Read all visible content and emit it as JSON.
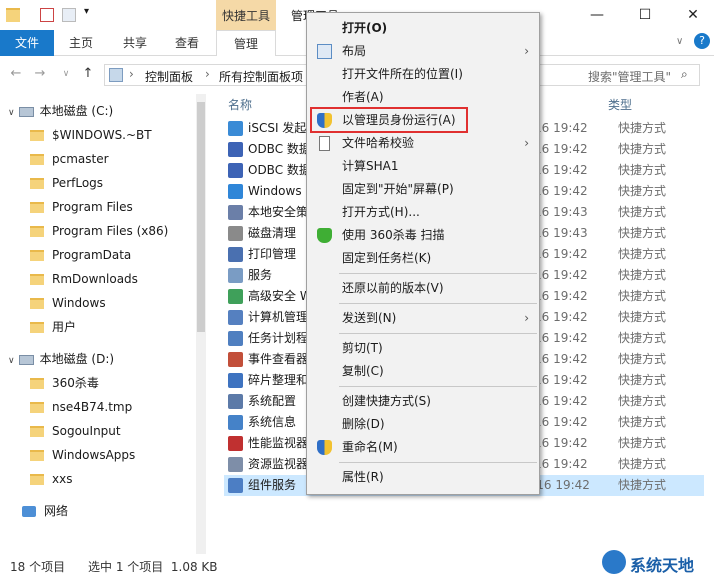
{
  "titlebar": {
    "tool_tab": "快捷工具",
    "title": "管理工具",
    "minimize": "—",
    "maximize": "☐",
    "close": "✕"
  },
  "ribbon": {
    "tabs": [
      "文件",
      "主页",
      "共享",
      "查看",
      "管理"
    ],
    "help": "?"
  },
  "address": {
    "path": [
      "控制面板",
      "所有控制面板项"
    ],
    "search_placeholder": "搜索\"管理工具\""
  },
  "nav": {
    "drive_c": "本地磁盘 (C:)",
    "c_items": [
      "$WINDOWS.~BT",
      "pcmaster",
      "PerfLogs",
      "Program Files",
      "Program Files (x86)",
      "ProgramData",
      "RmDownloads",
      "Windows",
      "用户"
    ],
    "drive_d": "本地磁盘 (D:)",
    "d_items": [
      "360杀毒",
      "nse4B74.tmp",
      "SogouInput",
      "WindowsApps",
      "xxs"
    ],
    "network": "网络"
  },
  "filelist": {
    "col_name": "名称",
    "col_type": "类型",
    "rows": [
      {
        "name": "iSCSI 发起",
        "date": "16 19:42",
        "type": "快捷方式"
      },
      {
        "name": "ODBC 数据",
        "date": "16 19:42",
        "type": "快捷方式"
      },
      {
        "name": "ODBC 数据",
        "date": "16 19:42",
        "type": "快捷方式"
      },
      {
        "name": "Windows",
        "date": "16 19:42",
        "type": "快捷方式"
      },
      {
        "name": "本地安全策",
        "date": "16 19:43",
        "type": "快捷方式"
      },
      {
        "name": "磁盘清理",
        "date": "16 19:43",
        "type": "快捷方式"
      },
      {
        "name": "打印管理",
        "date": "16 19:42",
        "type": "快捷方式"
      },
      {
        "name": "服务",
        "date": "16 19:42",
        "type": "快捷方式"
      },
      {
        "name": "高级安全 W",
        "date": "16 19:42",
        "type": "快捷方式"
      },
      {
        "name": "计算机管理",
        "date": "16 19:42",
        "type": "快捷方式"
      },
      {
        "name": "任务计划程",
        "date": "16 19:42",
        "type": "快捷方式"
      },
      {
        "name": "事件查看器",
        "date": "16 19:42",
        "type": "快捷方式"
      },
      {
        "name": "碎片整理和",
        "date": "16 19:42",
        "type": "快捷方式"
      },
      {
        "name": "系统配置",
        "date": "16 19:42",
        "type": "快捷方式"
      },
      {
        "name": "系统信息",
        "date": "16 19:42",
        "type": "快捷方式"
      },
      {
        "name": "性能监视器",
        "date": "16 19:42",
        "type": "快捷方式"
      },
      {
        "name": "资源监视器",
        "date": "16 19:42",
        "type": "快捷方式"
      },
      {
        "name": "组件服务",
        "date": "2016/7/16 19:42",
        "type": "快捷方式"
      }
    ]
  },
  "status": {
    "count": "18 个项目",
    "selected": "选中 1 个项目  1.08 KB"
  },
  "context_menu": {
    "items": [
      {
        "label": "打开(O)"
      },
      {
        "label": "布局"
      },
      {
        "label": "打开文件所在的位置(I)"
      },
      {
        "label": "作者(A)"
      },
      {
        "label": "以管理员身份运行(A)"
      },
      {
        "label": "文件哈希校验"
      },
      {
        "label": "计算SHA1"
      },
      {
        "label": "固定到\"开始\"屏幕(P)"
      },
      {
        "label": "打开方式(H)..."
      },
      {
        "label": "使用 360杀毒 扫描"
      },
      {
        "label": "固定到任务栏(K)"
      },
      {
        "label": "还原以前的版本(V)"
      },
      {
        "label": "发送到(N)"
      },
      {
        "label": "剪切(T)"
      },
      {
        "label": "复制(C)"
      },
      {
        "label": "创建快捷方式(S)"
      },
      {
        "label": "删除(D)"
      },
      {
        "label": "重命名(M)"
      },
      {
        "label": "属性(R)"
      }
    ]
  },
  "watermark": {
    "text": "系统天地"
  },
  "colors": {
    "file_tab": "#1979ca",
    "tool_tab": "#f5d9a7",
    "selection": "#cce8ff",
    "highlight_box": "#e03030"
  }
}
